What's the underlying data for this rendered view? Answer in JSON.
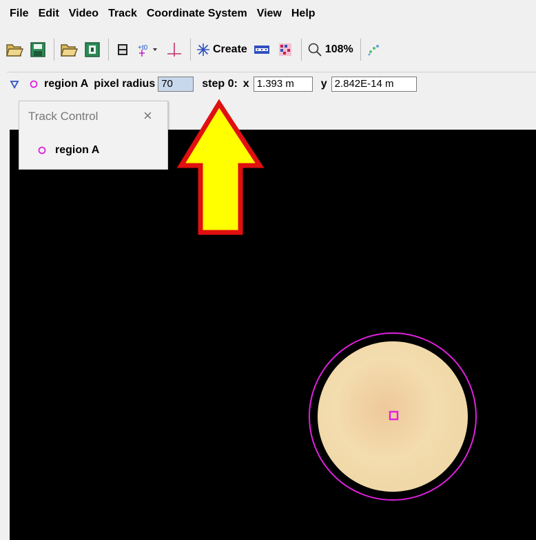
{
  "menu": [
    "File",
    "Edit",
    "Video",
    "Track",
    "Coordinate System",
    "View",
    "Help"
  ],
  "toolbar": {
    "create_label": "Create",
    "zoom_label": "108%"
  },
  "trackbar": {
    "track_name": "region A",
    "radius_label": "pixel radius",
    "radius_value": "70",
    "step_label": "step 0:",
    "x_label": "x",
    "x_value": "1.393 m",
    "y_label": "y",
    "y_value": "2.842E-14 m"
  },
  "track_control": {
    "title": "Track Control",
    "items": [
      "region A"
    ]
  },
  "colors": {
    "track": "#e020e0",
    "arrow_fill": "#ffff00",
    "arrow_outline": "#e01010",
    "disk_center": "#f5dcb0",
    "disk_edge": "#e6c48e"
  }
}
